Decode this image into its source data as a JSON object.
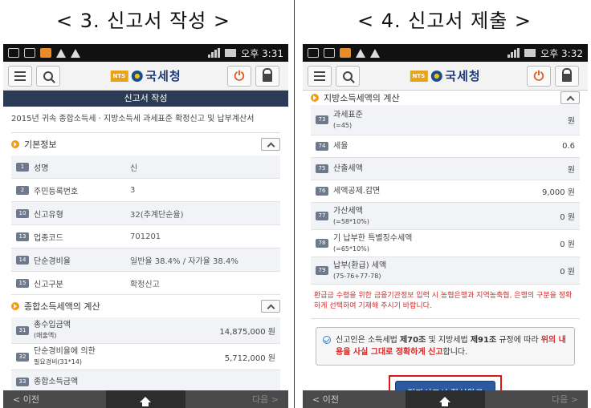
{
  "captions": {
    "left": "< 3. 신고서 작성 >",
    "right": "< 4. 신고서 제출 >"
  },
  "status": {
    "left_time": "오후 3:31",
    "right_time": "오후 3:32"
  },
  "header": {
    "logo_badge": "NTS",
    "logo_text": "국세청"
  },
  "left": {
    "page_title": "신고서 작성",
    "doc_title": "2015년 귀속 종합소득세 · 지방소득세 과세표준 확정신고 및 납부계산서",
    "section1": "기본정보",
    "rows": [
      {
        "num": "1",
        "label": "성명",
        "value": "신"
      },
      {
        "num": "2",
        "label": "주민등록번호",
        "value": "3"
      },
      {
        "num": "10",
        "label": "신고유형",
        "value": "32(추계단순율)"
      },
      {
        "num": "13",
        "label": "업종코드",
        "value": "701201"
      },
      {
        "num": "14",
        "label": "단순경비율",
        "value": "일반율 38.4% / 자가율 38.4%"
      },
      {
        "num": "15",
        "label": "신고구분",
        "value": "확정신고"
      }
    ],
    "section2": "종합소득세액의 계산",
    "calc_rows": [
      {
        "num": "31",
        "label": "총수입금액",
        "sub": "(매출액)",
        "amount": "14,875,000 원"
      },
      {
        "num": "32",
        "label": "단순경비율에 의한",
        "sub": "필요경비(31*14)",
        "amount": "5,712,000 원"
      },
      {
        "num": "33",
        "label": "종합소득금액",
        "sub": "",
        "amount": ""
      }
    ]
  },
  "right": {
    "section": "지방소득세액의 계산",
    "rows": [
      {
        "num": "73",
        "label": "과세표준",
        "sub": "(=45)",
        "amount": "원"
      },
      {
        "num": "74",
        "label": "세율",
        "sub": "",
        "amount": "0.6"
      },
      {
        "num": "75",
        "label": "산출세액",
        "sub": "",
        "amount": "원"
      },
      {
        "num": "76",
        "label": "세액공제.감면",
        "sub": "",
        "amount": "9,000 원"
      },
      {
        "num": "77",
        "label": "가산세액",
        "sub": "(=58*10%)",
        "amount": "0 원"
      },
      {
        "num": "78",
        "label": "기 납부한 특별징수세액",
        "sub": "(=65*10%)",
        "amount": "0 원"
      },
      {
        "num": "79",
        "label": "납부(환급) 세액",
        "sub": "(75-76+77-78)",
        "amount": "0 원"
      }
    ],
    "notice": "환급금 수령을 위한 금융기관정보 입력 시 농협은행과 지역농축협, 은행의 구분을 정확하게 선택하여 기재해 주시기 바랍니다.",
    "declare_prefix": "신고인은 소득세법 ",
    "declare_law1": "제70조",
    "declare_mid": " 및 지방세법 ",
    "declare_law2": "제91조",
    "declare_mid2": " 규정에 따라 ",
    "declare_red": "위의 내용을 사실 그대로 정확하게 신고",
    "declare_suffix": "합니다.",
    "submit_label": "전자신고서 작성완료"
  },
  "bottom": {
    "prev": "< 이전",
    "next": "다음 >"
  }
}
